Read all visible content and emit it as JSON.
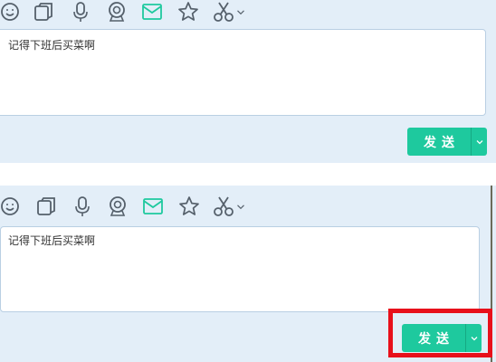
{
  "toolbar": {
    "icons": [
      "smiley-icon",
      "window-icon",
      "microphone-icon",
      "webcam-icon",
      "mail-icon",
      "star-icon",
      "scissors-icon",
      "chevron-down-icon"
    ]
  },
  "message": {
    "text": "记得下班后买菜啊"
  },
  "send": {
    "label": "发送",
    "dropdown_icon": "chevron-down-icon"
  },
  "colors": {
    "panel_bg": "#e3eef8",
    "accent": "#1ec99e",
    "icon_gray": "#55606b",
    "highlight": "#e8101b"
  }
}
